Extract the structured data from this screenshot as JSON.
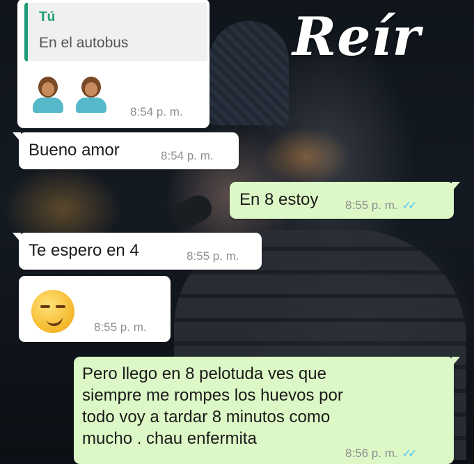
{
  "watermark": {
    "logo_text": "Reír"
  },
  "messages": [
    {
      "quote_author": "Tú",
      "quote_text": "En el autobus",
      "emoji": "two woman-facepalming emoji",
      "time": "8:54 p. m."
    },
    {
      "text": "Bueno amor",
      "time": "8:54 p. m."
    },
    {
      "text": "En 8 estoy",
      "time": "8:55 p. m.",
      "ticks": "✓✓"
    },
    {
      "text": "Te espero en 4",
      "time": "8:55 p. m."
    },
    {
      "emoji": "smirking-face emoji",
      "time": "8:55 p. m."
    },
    {
      "text_lines": [
        "Pero llego en 8 pelotuda ves que",
        "siempre me rompes los huevos por",
        "todo voy a tardar 8 minutos como",
        "mucho . chau enfermita"
      ],
      "time": "8:56 p. m.",
      "ticks": "✓✓"
    }
  ],
  "colors": {
    "incoming_bubble": "#ffffff",
    "outgoing_bubble": "#dcf8c6",
    "quote_accent": "#1e9c78",
    "read_ticks": "#4fc3f7"
  }
}
